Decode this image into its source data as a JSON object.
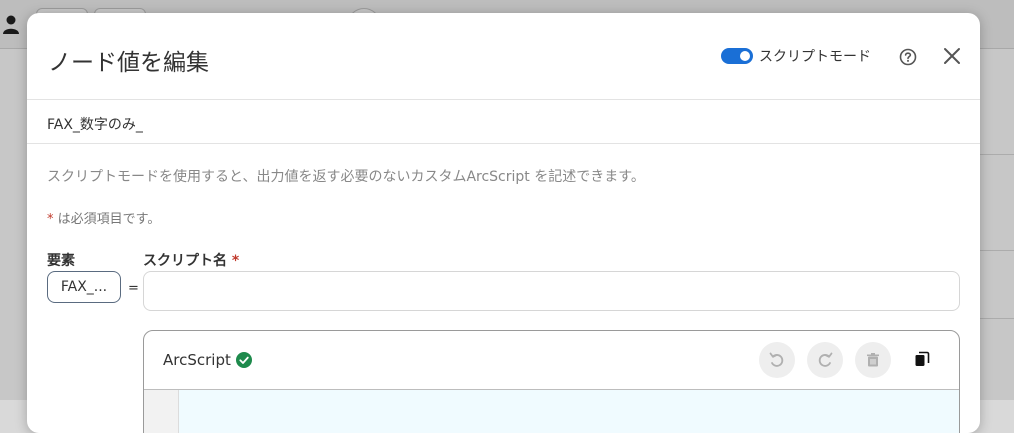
{
  "modal": {
    "title": "ノード値を編集",
    "toggle_label": "スクリプトモード",
    "toggle_on": true,
    "node_name": "FAX_数字のみ_",
    "description": "スクリプトモードを使用すると、出力値を返す必要のないカスタムArcScript を記述できます。",
    "required_mark": "*",
    "required_note": " は必須項目です。",
    "element_label": "要素",
    "element_value": "FAX_...",
    "equals": "=",
    "script_name_label": "スクリプト名",
    "script_name_value": "",
    "editor": {
      "language": "ArcScript",
      "status": "valid"
    }
  },
  "colors": {
    "accent": "#1a6fd6",
    "valid": "#1e8a4c",
    "required": "#c0392b"
  }
}
